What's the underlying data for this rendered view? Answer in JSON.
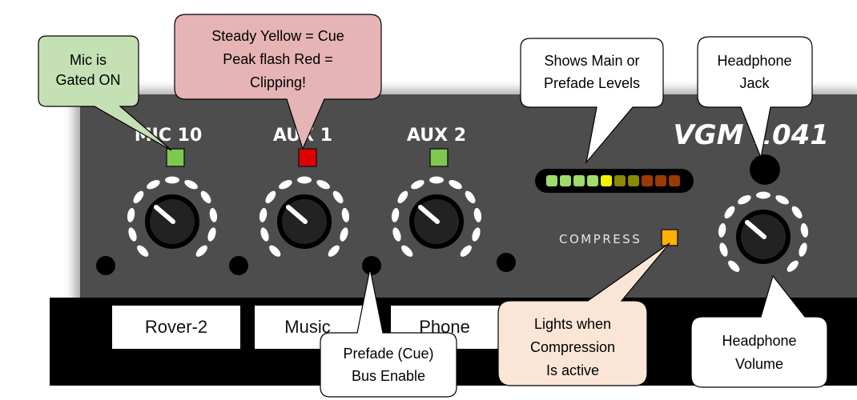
{
  "panel": {
    "channels": [
      {
        "label": "MIC 10",
        "led_color": "#7ec850",
        "strip": "Rover-2"
      },
      {
        "label": "AUX 1",
        "led_color": "#e00000",
        "strip": "Music"
      },
      {
        "label": "AUX 2",
        "led_color": "#7ec850",
        "strip": "Phone"
      }
    ],
    "model": "VGM 1041",
    "compress_label": "COMPRESS",
    "compress_led_color": "#ffb000",
    "meter_colors": [
      "#9fdc6a",
      "#9fdc6a",
      "#9fdc6a",
      "#9fdc6a",
      "#f2f200",
      "#8a8a00",
      "#8a8a00",
      "#9a3a00",
      "#9a3a00",
      "#9a3a00"
    ]
  },
  "callouts": {
    "gated": [
      "Mic is",
      "Gated ON"
    ],
    "cue": [
      "Steady Yellow = Cue",
      "Peak flash Red =",
      "Clipping!"
    ],
    "meter": [
      "Shows Main or",
      "Prefade Levels"
    ],
    "jack": [
      "Headphone",
      "Jack"
    ],
    "prefade": [
      "Prefade (Cue)",
      "Bus Enable"
    ],
    "compression": [
      "Lights when",
      "Compression",
      "Is active"
    ],
    "volume": [
      "Headphone",
      "Volume"
    ]
  },
  "colors": {
    "panel": "#4d4d4d",
    "strip": "#000000",
    "gated_fill": "#c5e0b4",
    "cue_fill": "#e6b4b4",
    "compression_fill": "#fbe5d6",
    "white_fill": "#ffffff"
  }
}
